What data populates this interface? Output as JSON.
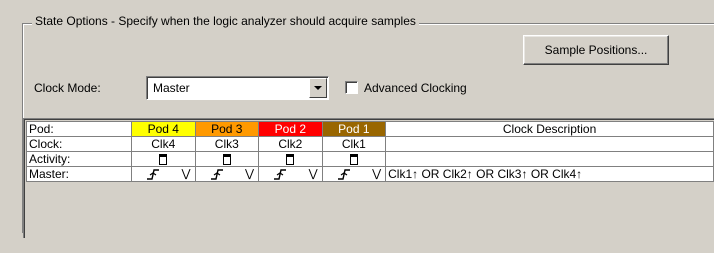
{
  "group": {
    "title": "State Options - Specify when the logic analyzer should acquire samples"
  },
  "toolbar": {
    "sample_positions_label": "Sample Positions..."
  },
  "clock_mode": {
    "label": "Clock Mode:",
    "value": "Master"
  },
  "advanced_clocking": {
    "label": "Advanced Clocking",
    "checked": false
  },
  "table": {
    "row_labels": [
      "Pod:",
      "Clock:",
      "Activity:",
      "Master:"
    ],
    "pods": [
      {
        "name": "Pod 4",
        "clock": "Clk4",
        "color": "#ffff00",
        "text_color": "#000000"
      },
      {
        "name": "Pod 3",
        "clock": "Clk3",
        "color": "#ff9900",
        "text_color": "#000000"
      },
      {
        "name": "Pod 2",
        "clock": "Clk2",
        "color": "#ff0000",
        "text_color": "#ffffff"
      },
      {
        "name": "Pod 1",
        "clock": "Clk1",
        "color": "#996600",
        "text_color": "#ffffff"
      }
    ],
    "description_header": "Clock Description",
    "master_description": "Clk1↑ OR Clk2↑ OR Clk3↑ OR Clk4↑",
    "icons": {
      "activity": "activity-indicator-icon",
      "edge": "rising-edge-icon",
      "expand": "double-chevron-down-icon"
    }
  }
}
